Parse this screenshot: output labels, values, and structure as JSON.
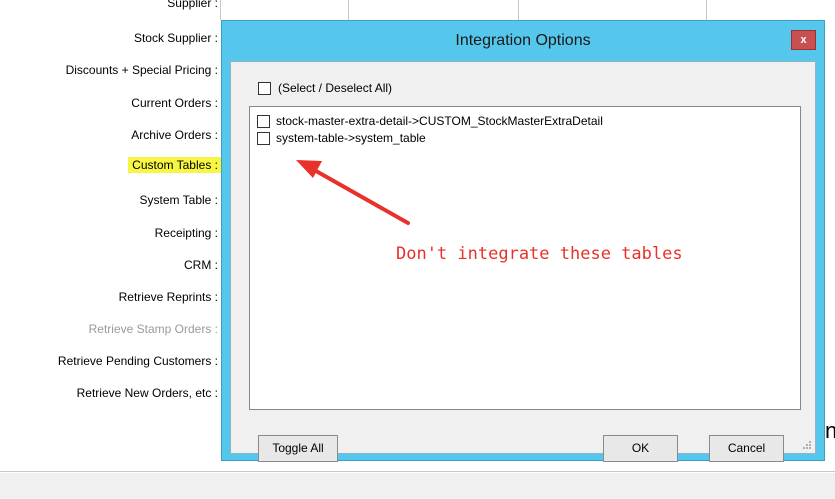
{
  "form_labels": {
    "supplier": "Supplier :",
    "stock_supplier": "Stock Supplier :",
    "discounts": "Discounts + Special Pricing :",
    "current_orders": "Current Orders :",
    "archive_orders": "Archive Orders :",
    "custom_tables": "Custom Tables :",
    "system_table": "System Table :",
    "receipting": "Receipting :",
    "crm": "CRM :",
    "retrieve_reprints": "Retrieve Reprints :",
    "retrieve_stamp_orders": "Retrieve Stamp Orders :",
    "retrieve_pending_customers": "Retrieve Pending Customers :",
    "retrieve_new_orders": "Retrieve New Orders, etc :"
  },
  "dialog": {
    "title": "Integration Options",
    "close_glyph": "x",
    "select_all_label": "(Select / Deselect All)",
    "items": [
      {
        "label": "stock-master-extra-detail->CUSTOM_StockMasterExtraDetail",
        "checked": false
      },
      {
        "label": "system-table->system_table",
        "checked": false
      }
    ],
    "annotation": "Don't integrate these tables",
    "toggle_all": "Toggle All",
    "ok": "OK",
    "cancel": "Cancel"
  },
  "background_partial_text": "n",
  "colors": {
    "title_bar": "#56c7ec",
    "close_button": "#c75050",
    "annotation": "#e8312a",
    "highlight": "#f7f743"
  }
}
